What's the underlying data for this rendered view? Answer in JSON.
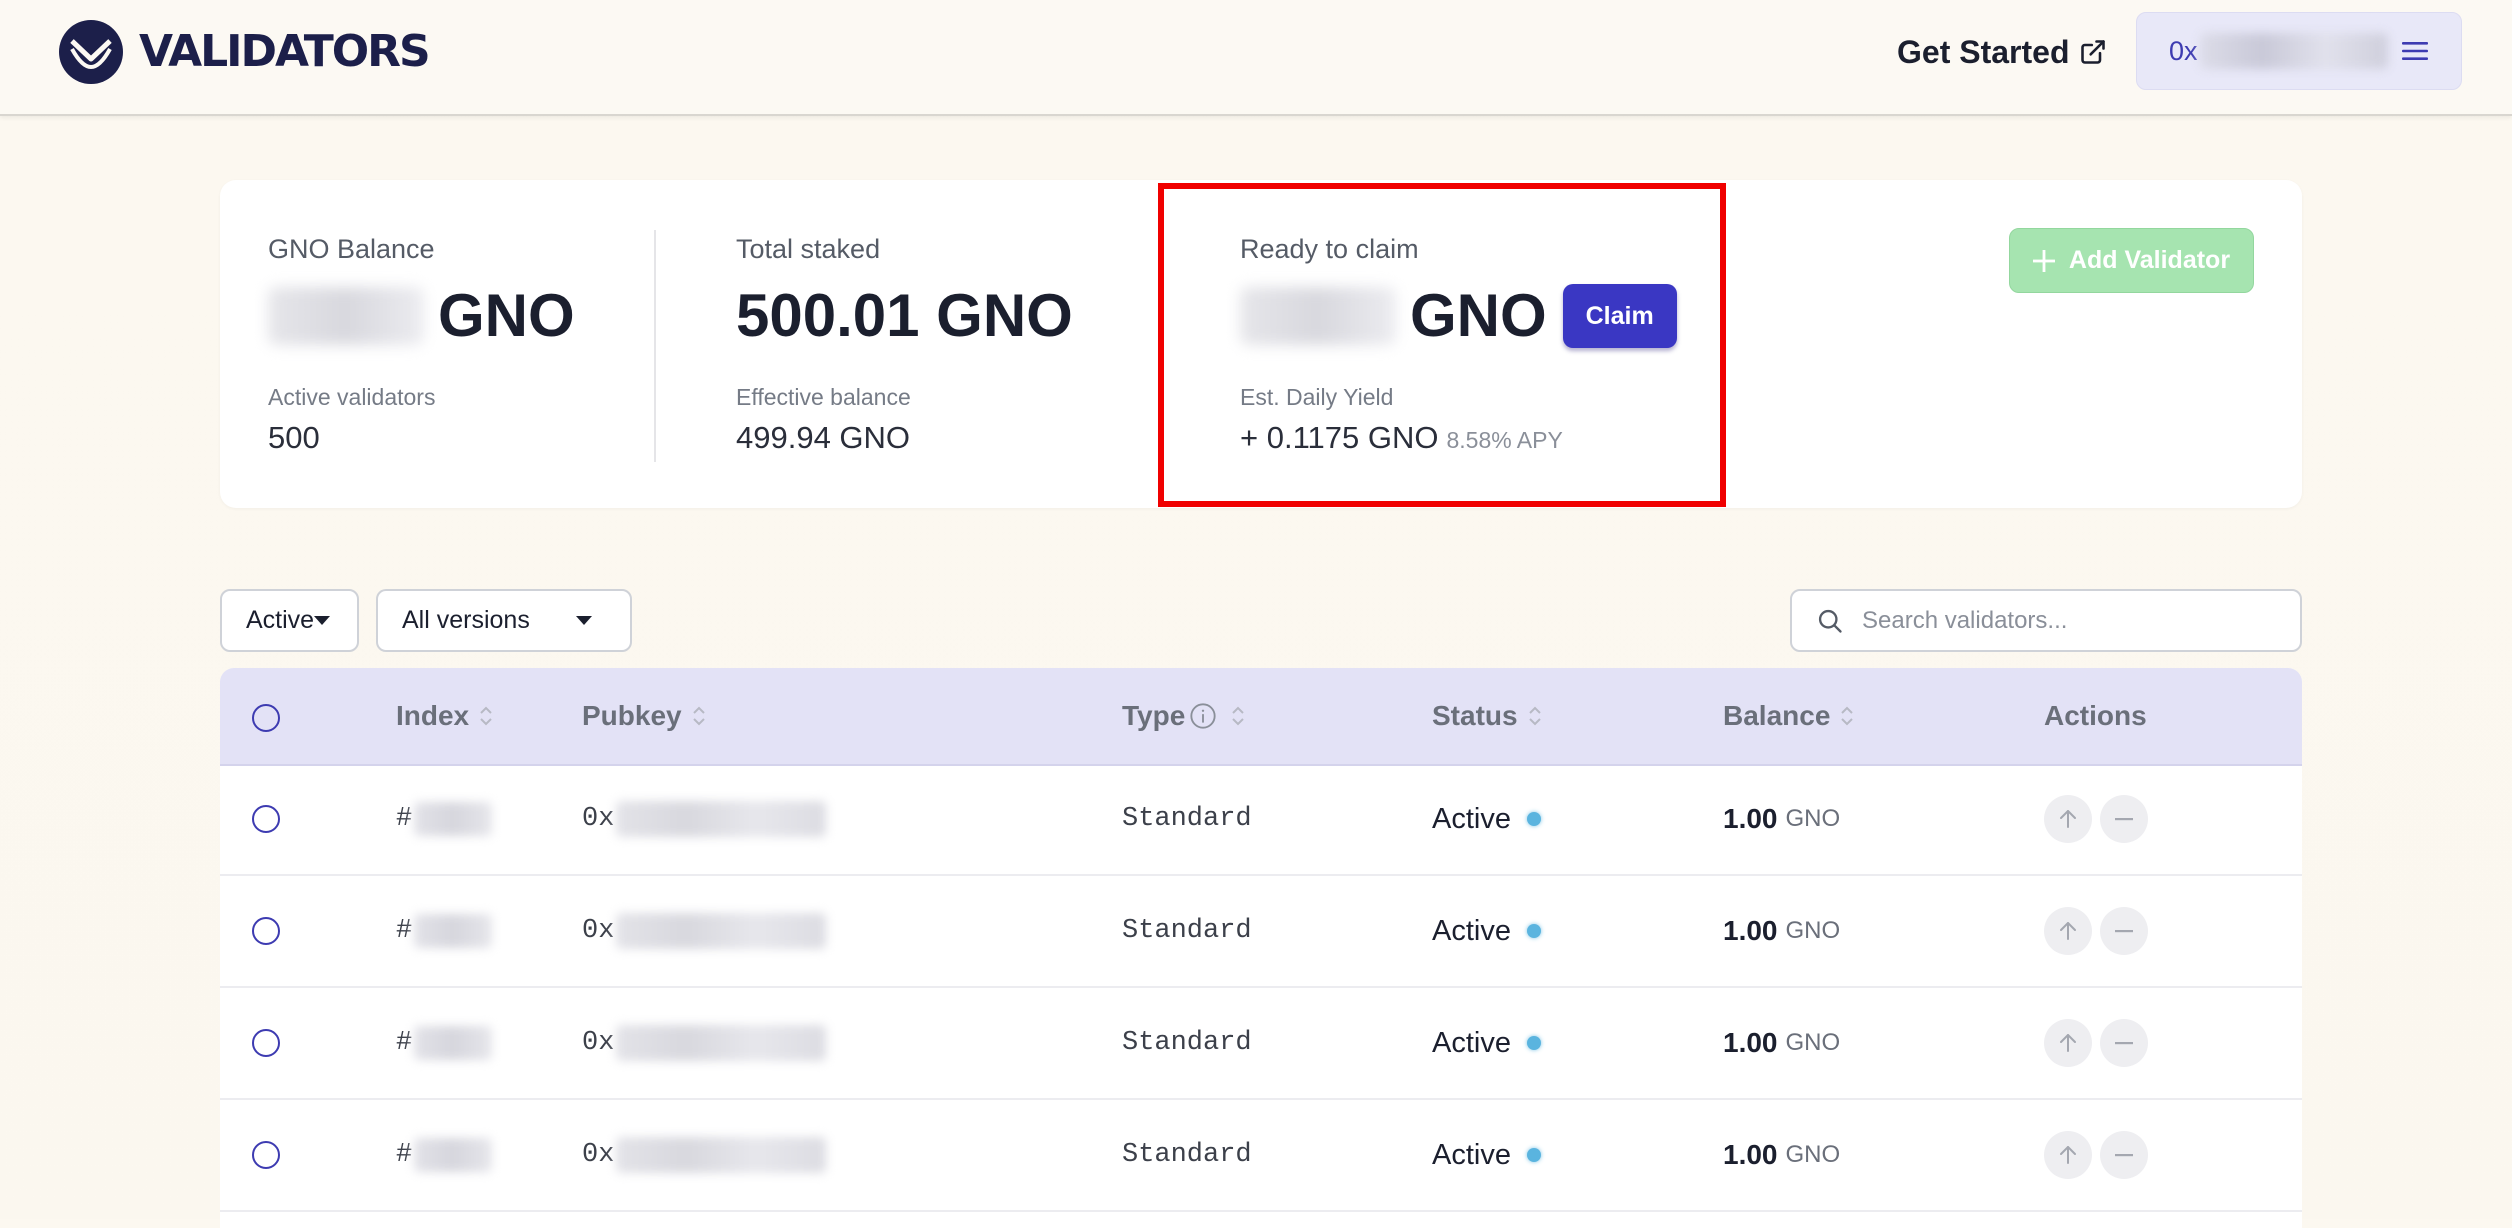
{
  "header": {
    "logo_text": "VALIDATORS",
    "get_started_label": "Get Started",
    "wallet_prefix": "0x"
  },
  "stats": {
    "gno_balance": {
      "label": "GNO Balance",
      "unit": "GNO"
    },
    "active_validators": {
      "label": "Active validators",
      "value": "500"
    },
    "total_staked": {
      "label": "Total staked",
      "value": "500.01 GNO"
    },
    "effective_balance": {
      "label": "Effective balance",
      "value": "499.94 GNO"
    },
    "ready_to_claim": {
      "label": "Ready to claim",
      "unit": "GNO"
    },
    "claim_label": "Claim",
    "daily_yield": {
      "label": "Est. Daily Yield",
      "value": "+ 0.1175 GNO",
      "apy": "8.58% APY"
    },
    "add_validator_label": "Add Validator"
  },
  "filters": {
    "status_selected": "Active",
    "version_selected": "All versions",
    "search_placeholder": "Search validators..."
  },
  "table": {
    "columns": [
      "Index",
      "Pubkey",
      "Type",
      "Status",
      "Balance",
      "Actions"
    ],
    "rows": [
      {
        "index_prefix": "#",
        "pubkey_prefix": "0x",
        "type": "Standard",
        "status": "Active",
        "balance": "1.00",
        "unit": "GNO"
      },
      {
        "index_prefix": "#",
        "pubkey_prefix": "0x",
        "type": "Standard",
        "status": "Active",
        "balance": "1.00",
        "unit": "GNO"
      },
      {
        "index_prefix": "#",
        "pubkey_prefix": "0x",
        "type": "Standard",
        "status": "Active",
        "balance": "1.00",
        "unit": "GNO"
      },
      {
        "index_prefix": "#",
        "pubkey_prefix": "0x",
        "type": "Standard",
        "status": "Active",
        "balance": "1.00",
        "unit": "GNO"
      }
    ]
  },
  "colors": {
    "accent": "#3a37c3",
    "highlight": "#f00000",
    "add_validator_bg": "#a6e4b0",
    "table_header_bg": "#e3e2f6",
    "status_dot": "#5ab4df"
  },
  "icons": {
    "logo": "validators-logo-icon",
    "external": "external-link-icon",
    "menu": "hamburger-menu-icon",
    "plus": "plus-icon",
    "search": "search-icon",
    "sort": "sort-arrows-icon",
    "info": "info-icon",
    "up": "arrow-up-icon",
    "minus": "minus-icon"
  }
}
